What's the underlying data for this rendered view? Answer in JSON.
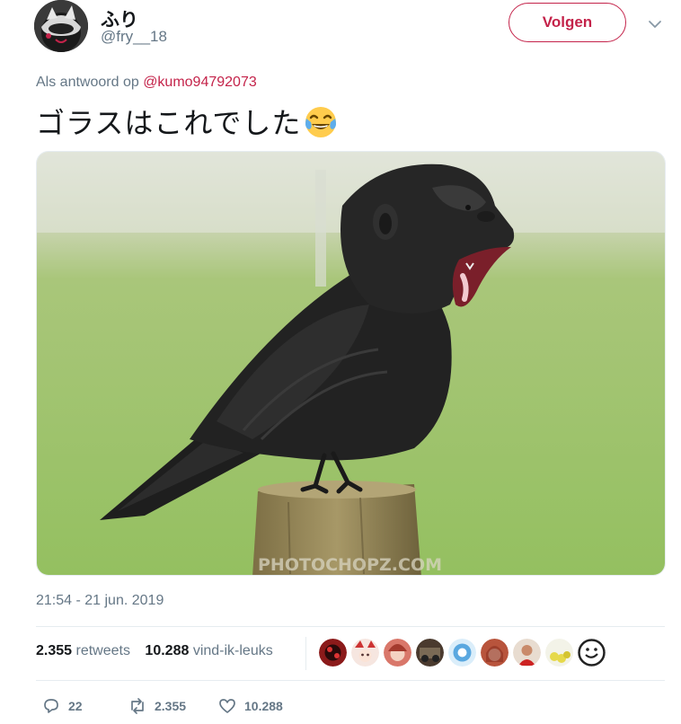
{
  "header": {
    "display_name": "ふり",
    "handle": "@fry__18",
    "follow_label": "Volgen",
    "menu_icon": "chevron-down-icon"
  },
  "reply": {
    "prefix": "Als antwoord op",
    "mention": "@kumo94792073"
  },
  "tweet": {
    "text": "ゴラスはこれでした",
    "emoji": "face-with-tears-of-joy",
    "watermark": "PHOTOCHOPZ.COM"
  },
  "meta": {
    "timestamp": "21:54 - 21 jun. 2019"
  },
  "stats": {
    "retweets_count": "2.355",
    "retweets_label": "retweets",
    "likes_count": "10.288",
    "likes_label": "vind-ik-leuks"
  },
  "likers": [
    {
      "name": "liker-1",
      "color": "#8b1a1a"
    },
    {
      "name": "liker-2",
      "color": "#f3d7d0"
    },
    {
      "name": "liker-3",
      "color": "#d9776a"
    },
    {
      "name": "liker-4",
      "color": "#4a3a2e"
    },
    {
      "name": "liker-5",
      "color": "#5aa8e0"
    },
    {
      "name": "liker-6",
      "color": "#b8543c"
    },
    {
      "name": "liker-7",
      "color": "#c98a6a"
    },
    {
      "name": "liker-8",
      "color": "#e6d94a"
    },
    {
      "name": "liker-9",
      "color": "#ffffff"
    }
  ],
  "actions": {
    "replies": "22",
    "retweets": "2.355",
    "likes": "10.288"
  },
  "colors": {
    "accent": "#c4234a",
    "muted": "#657786",
    "text": "#14171a",
    "border": "#e6ecf0"
  }
}
